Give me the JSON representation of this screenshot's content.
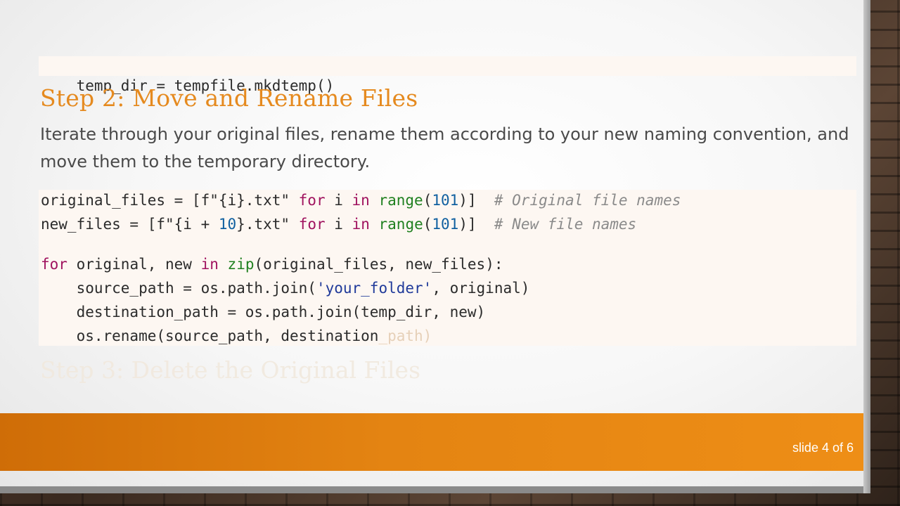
{
  "code_top": {
    "line": "temp_dir = tempfile.mkdtemp()"
  },
  "step2": {
    "heading": "Step 2: Move and Rename Files",
    "description": "Iterate through your original files, rename them according to your new naming convention, and move them to the temporary directory."
  },
  "code_main": {
    "line1": {
      "a": "original_files = [f\"{i}.txt\" ",
      "for": "for",
      "b": " i ",
      "in": "in",
      "c": " ",
      "range": "range",
      "d": "(",
      "num": "101",
      "e": ")]  ",
      "comment": "# Original file names"
    },
    "line2": {
      "a": "new_files = [f\"{i + ",
      "num1": "10",
      "b": "}.txt\" ",
      "for": "for",
      "c": " i ",
      "in": "in",
      "d": " ",
      "range": "range",
      "e": "(",
      "num2": "101",
      "f": ")]  ",
      "comment": "# New file names"
    },
    "line4": {
      "for": "for",
      "a": " original, new ",
      "in": "in",
      "b": " ",
      "zip": "zip",
      "c": "(original_files, new_files):"
    },
    "line5": {
      "a": "    source_path = os.path.join(",
      "str": "'your_folder'",
      "b": ", original)"
    },
    "line6": "    destination_path = os.path.join(temp_dir, new)",
    "line7": {
      "a": "    os.rename(source_path, destination",
      "fade": "_path)"
    }
  },
  "step3": {
    "heading": "Step 3: Delete the Original Files"
  },
  "footer": {
    "slide_number": "slide 4 of 6"
  },
  "colors": {
    "accent": "#e58a1f",
    "footer_bar": "#e48412",
    "code_bg": "#fdf7f2"
  }
}
